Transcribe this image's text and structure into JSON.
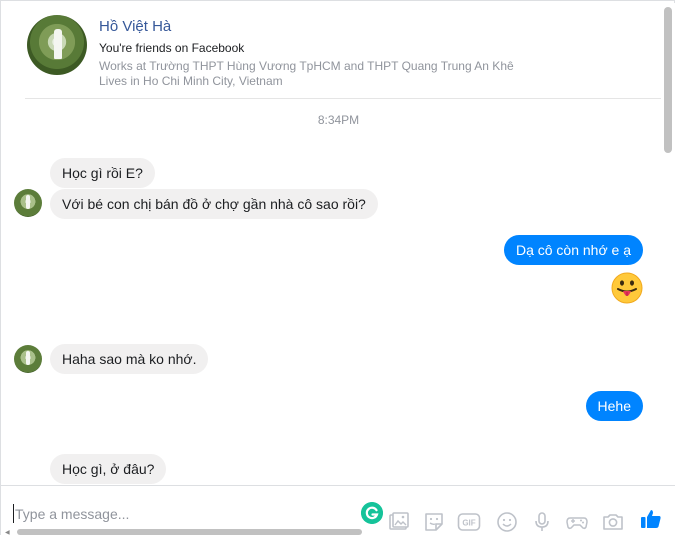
{
  "profile": {
    "name": "Hồ Việt Hà",
    "friends_status": "You're friends on Facebook",
    "works": "Works at Trường THPT Hùng Vương TpHCM and THPT Quang Trung An Khê",
    "lives": "Lives in Ho Chi Minh City, Vietnam"
  },
  "timestamp": "8:34PM",
  "messages": [
    {
      "from": "them",
      "text": "Học gì rồi E?"
    },
    {
      "from": "them",
      "text": "Với bé con chị bán đồ ở chợ gần nhà cô sao rồi?"
    },
    {
      "from": "me",
      "text": "Dạ cô còn nhớ e ạ"
    },
    {
      "from": "me",
      "emoji": "tongue-out-emoji"
    },
    {
      "from": "them",
      "text": "Haha sao mà ko nhớ."
    },
    {
      "from": "me",
      "text": "Hehe"
    },
    {
      "from": "them",
      "text": "Học gì, ở đâu?"
    }
  ],
  "composer": {
    "placeholder": "Type a message...",
    "value": ""
  },
  "colors": {
    "accent": "#0084ff",
    "incoming_bubble": "#f1f0f0",
    "link": "#365899",
    "muted": "#90949c",
    "grammarly": "#15c39a"
  },
  "icons": [
    "grammarly-icon",
    "image-icon",
    "sticker-icon",
    "gif-icon",
    "emoji-icon",
    "microphone-icon",
    "game-icon",
    "camera-icon",
    "like-icon"
  ]
}
